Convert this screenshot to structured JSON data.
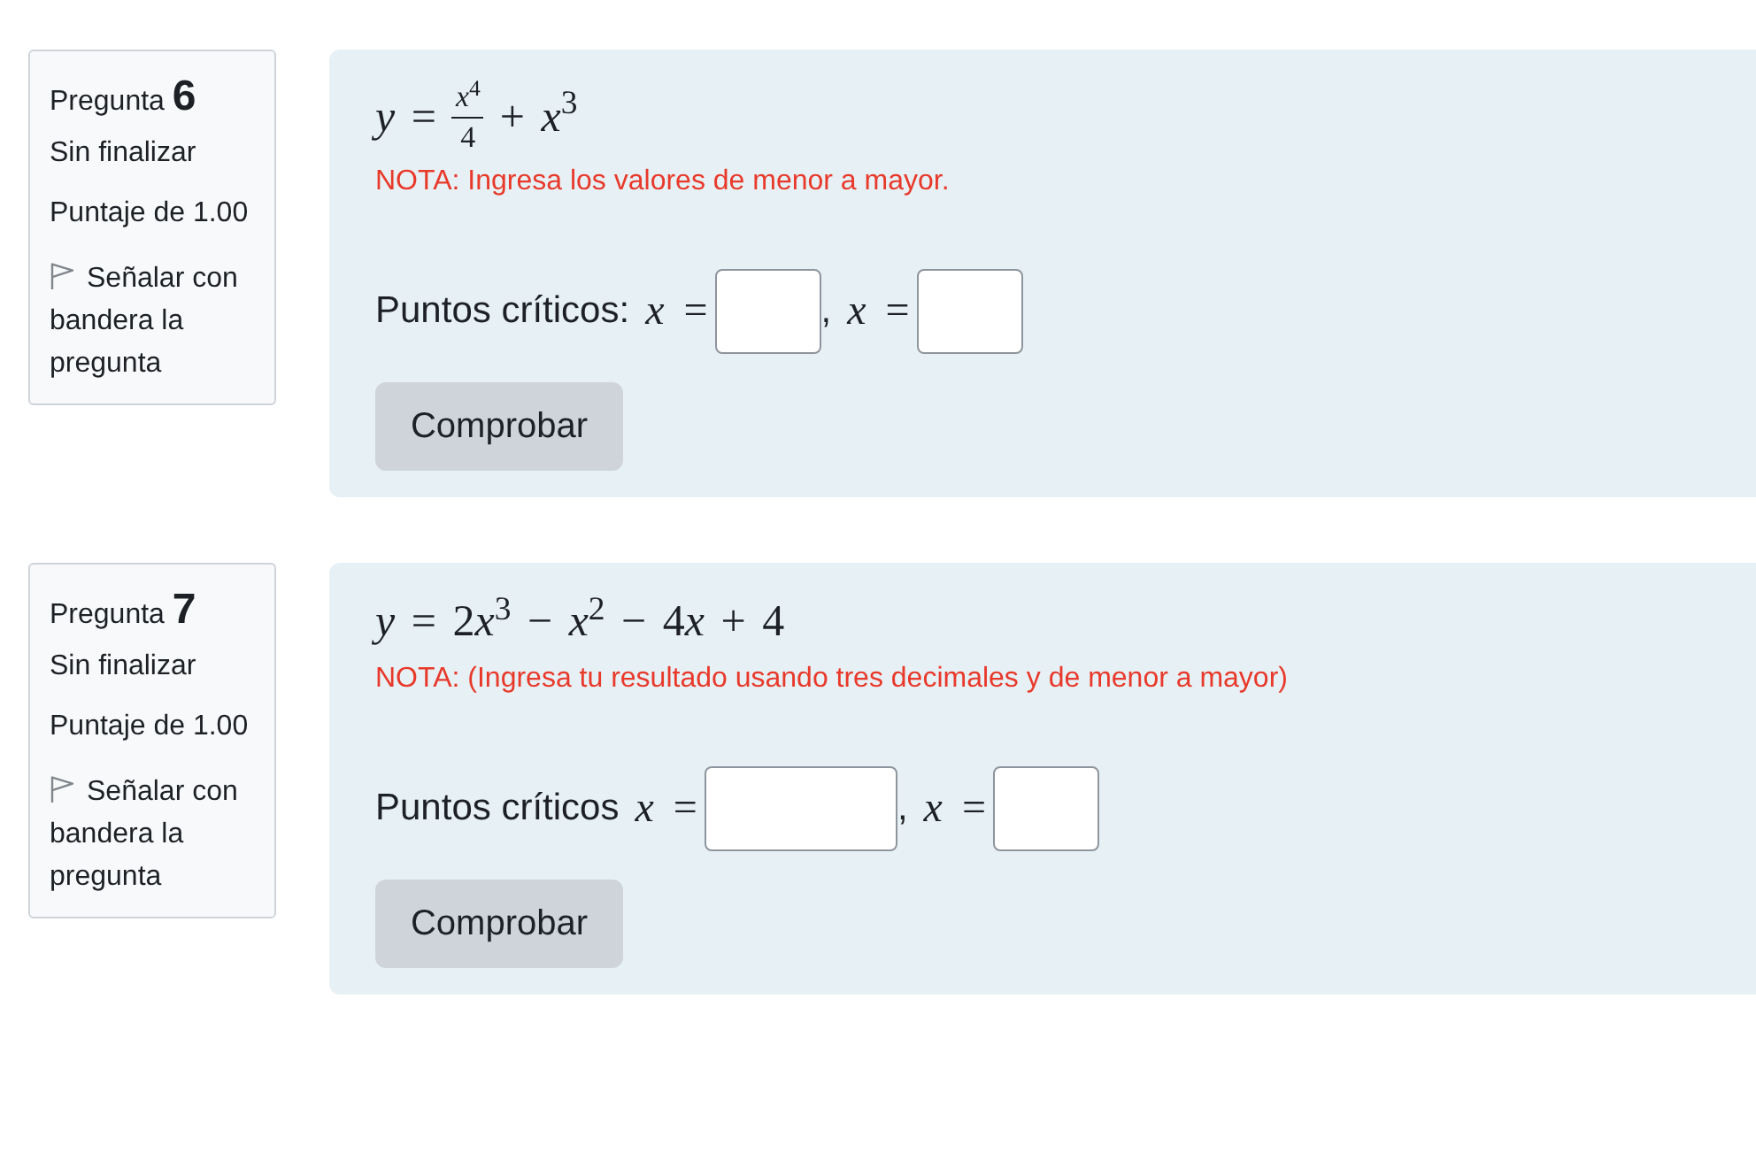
{
  "questions": [
    {
      "title": "Pregunta",
      "number": "6",
      "status": "Sin finalizar",
      "grade": "Puntaje de 1.00",
      "flag_link": {
        "text": "Señalar con bandera la pregunta",
        "flagged": false
      },
      "formula": [
        {
          "kind": "text",
          "text": "y ="
        },
        {
          "kind": "fraction",
          "numerator": "x$^{4}$",
          "denominator": "4"
        },
        {
          "kind": "text",
          "text": "+ x$^{3}$"
        }
      ],
      "note": "NOTA: Ingresa los valores de menor a mayor.",
      "answer": [
        {
          "kind": "label",
          "text": "Puntos críticos:"
        },
        {
          "kind": "math",
          "text": "x ="
        },
        {
          "kind": "input"
        },
        {
          "kind": "label",
          "text": ","
        },
        {
          "kind": "math",
          "text": "x ="
        },
        {
          "kind": "input"
        }
      ],
      "button": "Comprobar"
    },
    {
      "title": "Pregunta",
      "number": "7",
      "status": "Sin finalizar",
      "grade": "Puntaje de 1.00",
      "flag_link": {
        "text": "Señalar con bandera la pregunta",
        "flagged": false
      },
      "formula": [
        {
          "kind": "text",
          "text": "y = 2x$^{3}$ − x$^{2}$ − 4x + 4"
        }
      ],
      "note": "NOTA: (Ingresa tu resultado usando tres decimales y de menor a mayor)",
      "answer": [
        {
          "kind": "label",
          "text": "Puntos críticos"
        },
        {
          "kind": "math",
          "text": "x ="
        },
        {
          "kind": "wideinput"
        },
        {
          "kind": "label",
          "text": ","
        },
        {
          "kind": "math",
          "text": "x ="
        },
        {
          "kind": "input"
        }
      ],
      "button": "Comprobar"
    }
  ]
}
